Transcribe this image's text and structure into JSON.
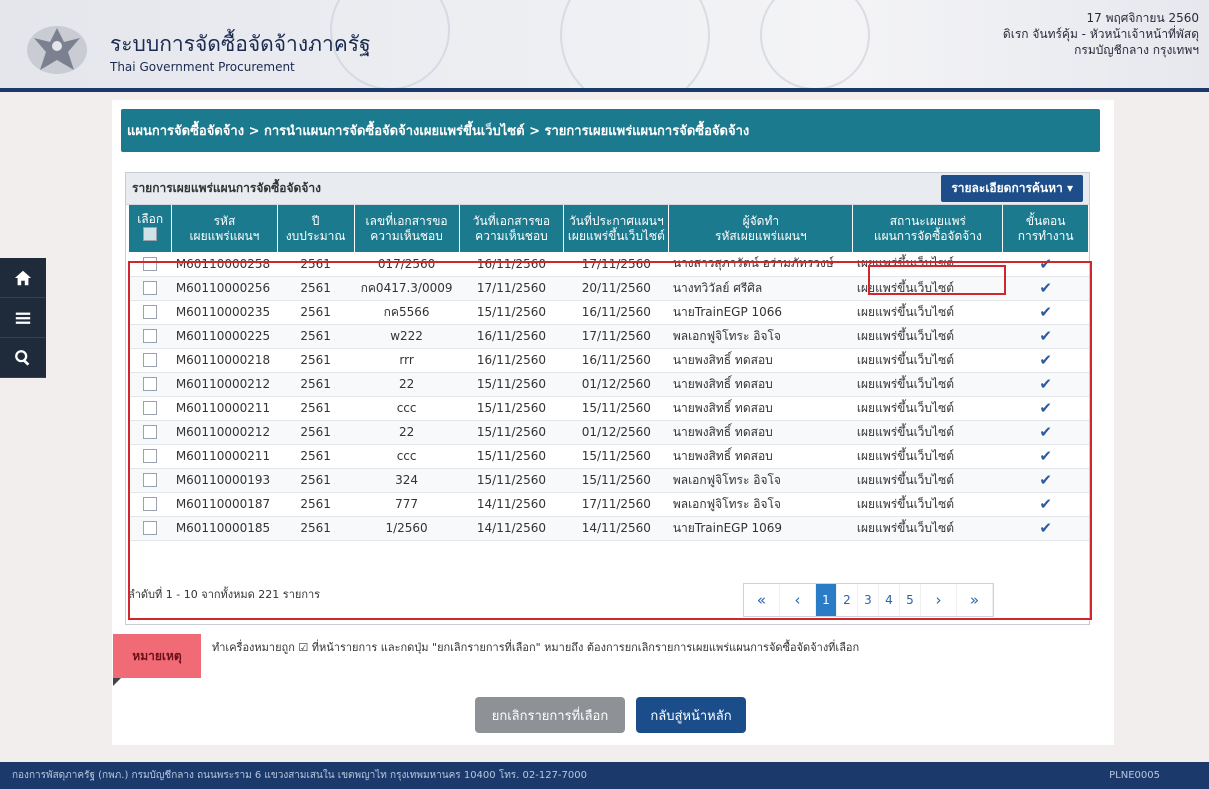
{
  "header": {
    "system_title": "ระบบการจัดซื้อจัดจ้างภาครัฐ",
    "system_subtitle": "Thai Government Procurement",
    "date": "17 พฤศจิกายน 2560",
    "user": "ดิเรก จันทร์คุ้ม - หัวหน้าเจ้าหน้าที่พัสดุ",
    "department": "กรมบัญชีกลาง กรุงเทพฯ"
  },
  "breadcrumb": "แผนการจัดซื้อจัดจ้าง > การนำแผนการจัดซื้อจัดจ้างเผยแพร่ขึ้นเว็บไซต์ > รายการเผยแพร่แผนการจัดซื้อจัดจ้าง",
  "list": {
    "title": "รายการเผยแพร่แผนการจัดซื้อจัดจ้าง",
    "search_button": "รายละเอียดการค้นหา ▾",
    "columns": [
      [
        "เลือก"
      ],
      [
        "รหัส",
        "เผยแพร่แผนฯ"
      ],
      [
        "ปี",
        "งบประมาณ"
      ],
      [
        "เลขที่เอกสารขอ",
        "ความเห็นชอบ"
      ],
      [
        "วันที่เอกสารขอ",
        "ความเห็นชอบ"
      ],
      [
        "วันที่ประกาศแผนฯ",
        "เผยแพร่ขึ้นเว็บไซต์"
      ],
      [
        "ผู้จัดทำ",
        "รหัสเผยแพร่แผนฯ"
      ],
      [
        "สถานะเผยแพร่",
        "แผนการจัดซื้อจัดจ้าง"
      ],
      [
        "ขั้นตอน",
        "การทำงาน"
      ]
    ],
    "rows": [
      {
        "code": "M60110000258",
        "year": "2561",
        "doc": "017/2560",
        "doc_date": "16/11/2560",
        "pub_date": "17/11/2560",
        "maker": "นางสาวสุภารัตน์ อร่ามภัทรวงษ์",
        "status": "เผยแพร่ขึ้นเว็บไซต์"
      },
      {
        "code": "M60110000256",
        "year": "2561",
        "doc": "กค0417.3/0009",
        "doc_date": "17/11/2560",
        "pub_date": "20/11/2560",
        "maker": "นางทวิวัลย์ ศรีศิล",
        "status": "เผยแพร่ขึ้นเว็บไซต์"
      },
      {
        "code": "M60110000235",
        "year": "2561",
        "doc": "กค5566",
        "doc_date": "15/11/2560",
        "pub_date": "16/11/2560",
        "maker": "นายTrainEGP 1066",
        "status": "เผยแพร่ขึ้นเว็บไซต์"
      },
      {
        "code": "M60110000225",
        "year": "2561",
        "doc": "w222",
        "doc_date": "16/11/2560",
        "pub_date": "17/11/2560",
        "maker": "พลเอกฟูจิโทระ อิจโจ",
        "status": "เผยแพร่ขึ้นเว็บไซต์"
      },
      {
        "code": "M60110000218",
        "year": "2561",
        "doc": "rrr",
        "doc_date": "16/11/2560",
        "pub_date": "16/11/2560",
        "maker": "นายพงสิทธิ์ ทดสอบ",
        "status": "เผยแพร่ขึ้นเว็บไซต์"
      },
      {
        "code": "M60110000212",
        "year": "2561",
        "doc": "22",
        "doc_date": "15/11/2560",
        "pub_date": "01/12/2560",
        "maker": "นายพงสิทธิ์ ทดสอบ",
        "status": "เผยแพร่ขึ้นเว็บไซต์"
      },
      {
        "code": "M60110000211",
        "year": "2561",
        "doc": "ccc",
        "doc_date": "15/11/2560",
        "pub_date": "15/11/2560",
        "maker": "นายพงสิทธิ์ ทดสอบ",
        "status": "เผยแพร่ขึ้นเว็บไซต์"
      },
      {
        "code": "M60110000212",
        "year": "2561",
        "doc": "22",
        "doc_date": "15/11/2560",
        "pub_date": "01/12/2560",
        "maker": "นายพงสิทธิ์ ทดสอบ",
        "status": "เผยแพร่ขึ้นเว็บไซต์"
      },
      {
        "code": "M60110000211",
        "year": "2561",
        "doc": "ccc",
        "doc_date": "15/11/2560",
        "pub_date": "15/11/2560",
        "maker": "นายพงสิทธิ์ ทดสอบ",
        "status": "เผยแพร่ขึ้นเว็บไซต์"
      },
      {
        "code": "M60110000193",
        "year": "2561",
        "doc": "324",
        "doc_date": "15/11/2560",
        "pub_date": "15/11/2560",
        "maker": "พลเอกฟูจิโทระ อิจโจ",
        "status": "เผยแพร่ขึ้นเว็บไซต์"
      },
      {
        "code": "M60110000187",
        "year": "2561",
        "doc": "777",
        "doc_date": "14/11/2560",
        "pub_date": "17/11/2560",
        "maker": "พลเอกฟูจิโทระ อิจโจ",
        "status": "เผยแพร่ขึ้นเว็บไซต์"
      },
      {
        "code": "M60110000185",
        "year": "2561",
        "doc": "1/2560",
        "doc_date": "14/11/2560",
        "pub_date": "14/11/2560",
        "maker": "นายTrainEGP 1069",
        "status": "เผยแพร่ขึ้นเว็บไซต์"
      }
    ],
    "row_action_icon": "check-icon",
    "summary": "ลำดับที่ 1 - 10 จากทั้งหมด 221 รายการ",
    "pagination": {
      "first": "«",
      "prev": "‹",
      "pages": [
        "1",
        "2",
        "3",
        "4",
        "5"
      ],
      "current": "1",
      "next": "›",
      "last": "»"
    }
  },
  "note": {
    "tag": "หมายเหตุ",
    "text_before": "ทำเครื่องหมายถูก",
    "text_after": "ที่หน้ารายการ และกดปุ่ม \"ยกเลิกรายการที่เลือก\" หมายถึง ต้องการยกเลิกรายการเผยแพร่แผนการจัดซื้อจัดจ้างที่เลือก"
  },
  "buttons": {
    "cancel_selected": "ยกเลิกรายการที่เลือก",
    "back_home": "กลับสู่หน้าหลัก"
  },
  "footer": {
    "address": "กองการพัสดุภาครัฐ (กพภ.) กรมบัญชีกลาง ถนนพระราม 6 แขวงสามเสนใน เขตพญาไท กรุงเทพมหานคร 10400 โทร. 02-127-7000",
    "page_code": "PLNE0005"
  },
  "colors": {
    "teal_header": "#1b7a8e",
    "navy": "#1b3a6b",
    "highlight_red": "#d0262e",
    "note_pink": "#f06b75"
  }
}
